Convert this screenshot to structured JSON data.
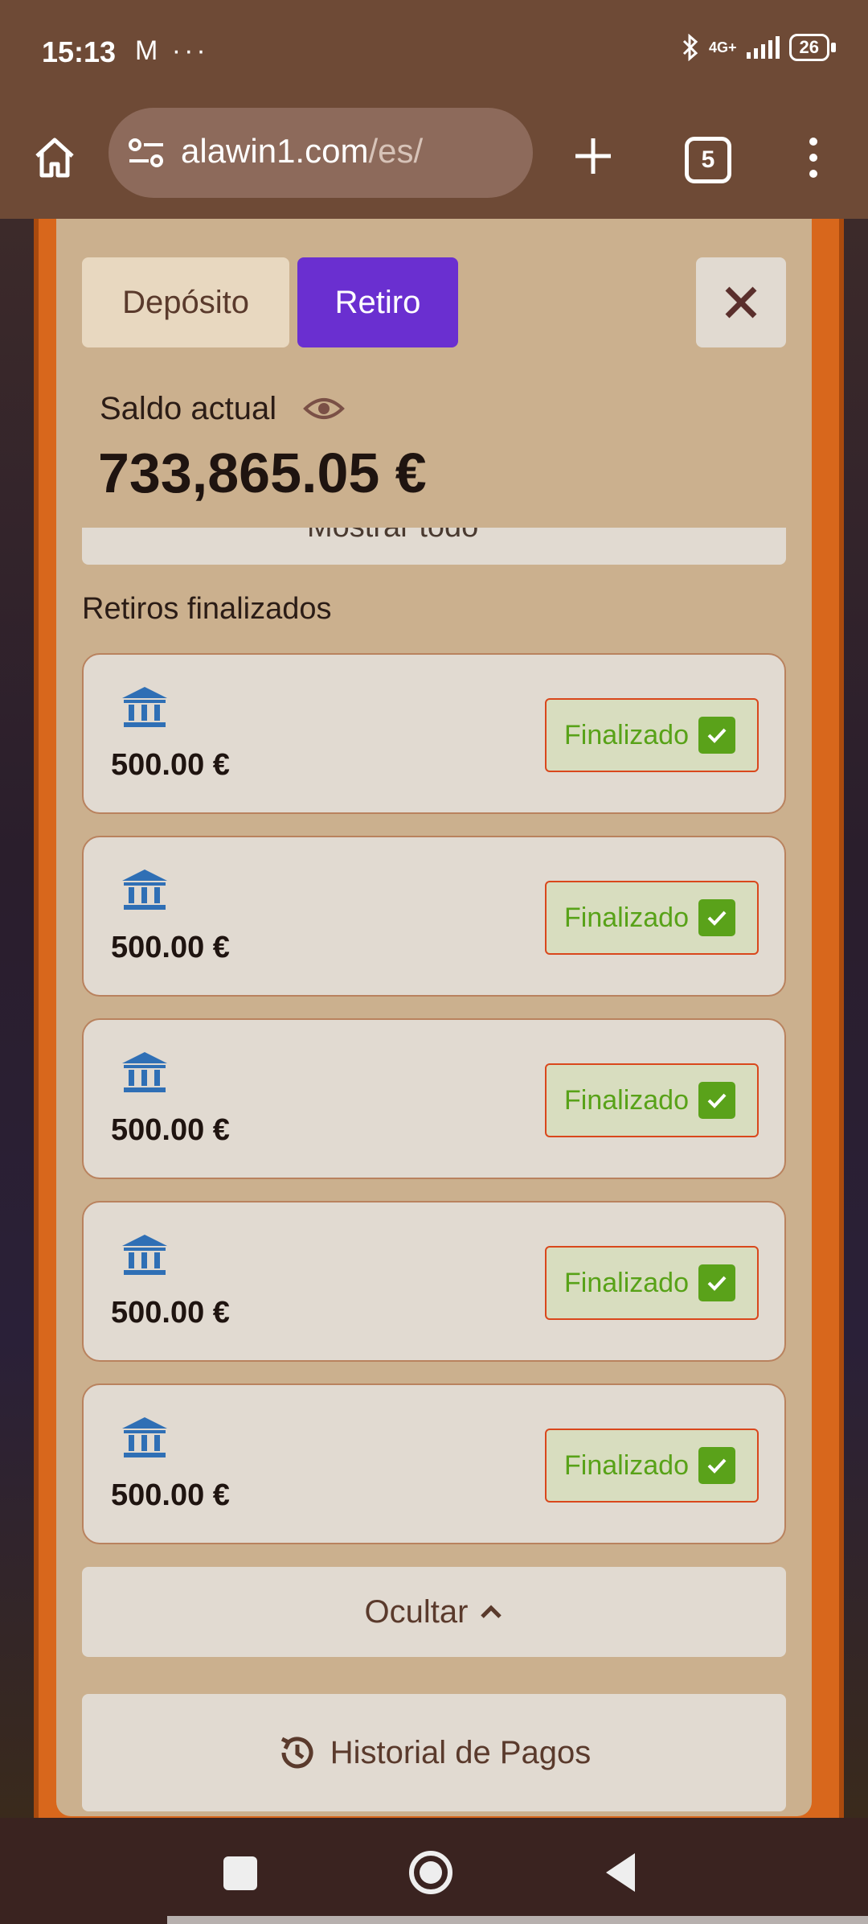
{
  "status_bar": {
    "time": "15:13",
    "left_icons": "M ···",
    "network": "4G+",
    "battery": "26"
  },
  "browser": {
    "url_domain": "alawin1.com",
    "url_path": "/es/",
    "tab_count": "5"
  },
  "panel": {
    "tabs": [
      {
        "label": "Depósito",
        "active": false
      },
      {
        "label": "Retiro",
        "active": true
      }
    ],
    "balance_label": "Saldo actual",
    "balance_value": "733,865.05 €",
    "cut_text": "Mostrar todo",
    "section_title": "Retiros finalizados",
    "withdrawals": [
      {
        "amount": "500.00 €",
        "status": "Finalizado",
        "icon": "bank-icon"
      },
      {
        "amount": "500.00 €",
        "status": "Finalizado",
        "icon": "bank-icon"
      },
      {
        "amount": "500.00 €",
        "status": "Finalizado",
        "icon": "bank-icon"
      },
      {
        "amount": "500.00 €",
        "status": "Finalizado",
        "icon": "bank-icon"
      },
      {
        "amount": "500.00 €",
        "status": "Finalizado",
        "icon": "bank-icon"
      }
    ],
    "hide_label": "Ocultar",
    "history_label": "Historial de Pagos"
  },
  "colors": {
    "accent": "#6a2fd0",
    "success": "#5aa21a",
    "panel": "#cbb08e",
    "frame": "#d8671c"
  }
}
